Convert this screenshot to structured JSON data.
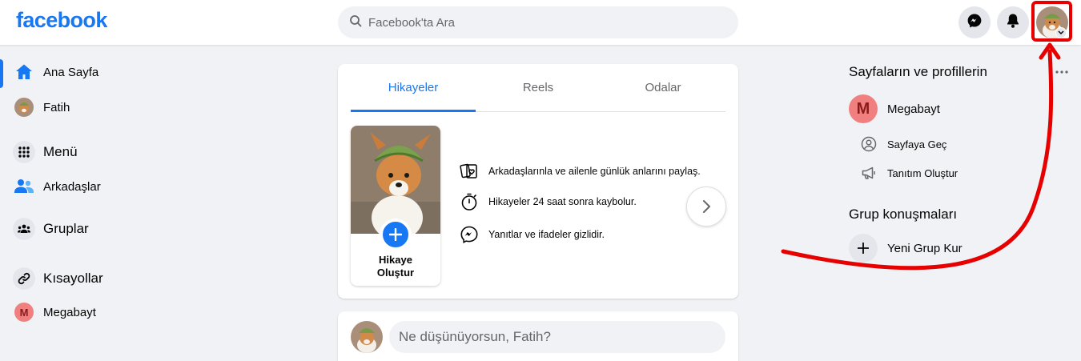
{
  "brand": {
    "logo": "facebook",
    "accent": "#1877f2"
  },
  "search": {
    "placeholder": "Facebook'ta Ara"
  },
  "header_icons": [
    "messenger-icon",
    "notifications-bell-icon",
    "account-avatar"
  ],
  "left_nav": {
    "items": [
      {
        "label": "Ana Sayfa",
        "icon": "home-icon",
        "active": true
      },
      {
        "label": "Fatih",
        "icon": "profile-avatar"
      },
      {
        "label": "Menü",
        "icon": "grid-menu-icon"
      },
      {
        "label": "Arkadaşlar",
        "icon": "friends-icon"
      },
      {
        "label": "Gruplar",
        "icon": "groups-icon"
      },
      {
        "label": "Kısayollar",
        "icon": "link-icon"
      },
      {
        "label": "Megabayt",
        "icon": "page-avatar",
        "avatar_letter": "M"
      }
    ]
  },
  "stories": {
    "tabs": [
      {
        "label": "Hikayeler",
        "active": true
      },
      {
        "label": "Reels"
      },
      {
        "label": "Odalar"
      }
    ],
    "create_label_line1": "Hikaye",
    "create_label_line2": "Oluştur",
    "info": [
      {
        "icon": "cards-heart-icon",
        "text": "Arkadaşlarınla ve ailenle günlük anlarını paylaş."
      },
      {
        "icon": "stopwatch-icon",
        "text": "Hikayeler 24 saat sonra kaybolur."
      },
      {
        "icon": "messenger-icon",
        "text": "Yanıtlar ve ifadeler gizlidir."
      }
    ]
  },
  "composer": {
    "placeholder": "Ne düşünüyorsun, Fatih?"
  },
  "right": {
    "pages_heading": "Sayfaların ve profillerin",
    "page_name": "Megabayt",
    "page_avatar_letter": "M",
    "actions": [
      {
        "label": "Sayfaya Geç",
        "icon": "switch-profile-icon"
      },
      {
        "label": "Tanıtım Oluştur",
        "icon": "megaphone-icon"
      }
    ],
    "groups_heading": "Grup konuşmaları",
    "new_group_label": "Yeni Grup Kur"
  },
  "annotation_color": "#e60000"
}
